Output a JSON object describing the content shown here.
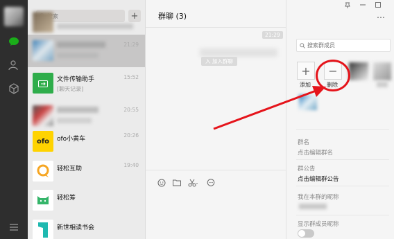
{
  "conversation_list": {
    "search_placeholder": "搜索",
    "items": [
      {
        "name": "",
        "preview": "",
        "time": "",
        "blurred": true
      },
      {
        "name": "",
        "preview": "",
        "time": "21:29",
        "blurred": true
      },
      {
        "name": "文件传输助手",
        "preview": "[聊天记录]",
        "time": "15:52",
        "color": "#2fad4b"
      },
      {
        "name": "",
        "preview": "",
        "time": "20:55",
        "blurred": true
      },
      {
        "name": "ofo小黄车",
        "preview": "",
        "time": "20:26",
        "color": "#ffd300",
        "logo_text": "ofo"
      },
      {
        "name": "轻松互助",
        "preview": "",
        "time": "19:40",
        "color": "#f6a623"
      },
      {
        "name": "轻松筹",
        "preview": "",
        "time": "",
        "color": "#35b56a"
      },
      {
        "name": "新世相读书会",
        "preview": "",
        "time": "",
        "color": "#1fb9b0"
      }
    ]
  },
  "chat": {
    "title": "群聊 (3)",
    "time_stamp": "21:29",
    "system_message": "入 加入群聊"
  },
  "panel": {
    "search_placeholder": "搜索群成员",
    "add_label": "添加",
    "delete_label": "删除",
    "group_name_label": "群名",
    "group_name_value": "点击编辑群名",
    "announcement_label": "群公告",
    "announcement_value": "点击编辑群公告",
    "nickname_label": "我在本群的昵称",
    "show_nickname_label": "显示群成员昵称"
  },
  "colors": {
    "annotation": "#e5141b",
    "sidebar": "#2e2e2e",
    "accent_green": "#1aad19"
  }
}
